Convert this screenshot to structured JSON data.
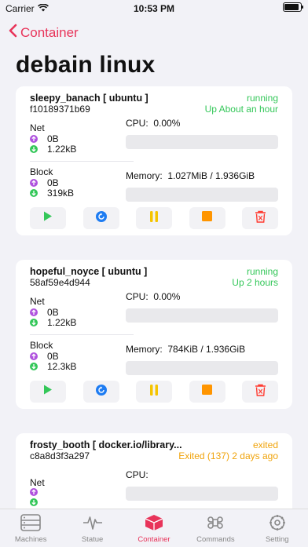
{
  "status_bar": {
    "carrier": "Carrier",
    "time": "10:53 PM"
  },
  "nav": {
    "back_label": "Container"
  },
  "title": "debain linux",
  "labels": {
    "net": "Net",
    "block": "Block",
    "cpu": "CPU:",
    "memory": "Memory:"
  },
  "containers": [
    {
      "name": "sleepy_banach [ ubuntu ]",
      "id": "f10189371b69",
      "state": "running",
      "uptime": "Up About an hour",
      "net": {
        "tx": "0B",
        "rx": "1.22kB"
      },
      "block": {
        "read": "0B",
        "write": "319kB"
      },
      "cpu": "0.00%",
      "memory": "1.027MiB / 1.936GiB",
      "colors": {
        "status": "#34c759"
      }
    },
    {
      "name": "hopeful_noyce [ ubuntu ]",
      "id": "58af59e4d944",
      "state": "running",
      "uptime": "Up 2 hours",
      "net": {
        "tx": "0B",
        "rx": "1.22kB"
      },
      "block": {
        "read": "0B",
        "write": "12.3kB"
      },
      "cpu": "0.00%",
      "memory": "784KiB / 1.936GiB",
      "colors": {
        "status": "#34c759"
      }
    },
    {
      "name": "frosty_booth [ docker.io/library...",
      "id": "c8a8d3f3a297",
      "state": "exited",
      "uptime": "Exited (137) 2 days ago",
      "net": {
        "tx": "",
        "rx": ""
      },
      "cpu": "",
      "colors": {
        "status": "#f0a30a"
      }
    }
  ],
  "action_icons": [
    "play-icon",
    "restart-icon",
    "pause-icon",
    "stop-icon",
    "trash-icon"
  ],
  "tabs": [
    {
      "label": "Machines",
      "icon": "server-icon"
    },
    {
      "label": "Statue",
      "icon": "pulse-icon"
    },
    {
      "label": "Container",
      "icon": "box-icon",
      "active": true
    },
    {
      "label": "Commands",
      "icon": "command-icon"
    },
    {
      "label": "Setting",
      "icon": "gear-icon"
    }
  ],
  "colors": {
    "accent": "#e8345a",
    "running": "#34c759",
    "exited": "#f0a30a",
    "upload": "#af52de",
    "download": "#34c759",
    "restart": "#1e7cf2",
    "pause": "#f5c400",
    "stop": "#ff9500",
    "delete": "#ff3b30"
  }
}
